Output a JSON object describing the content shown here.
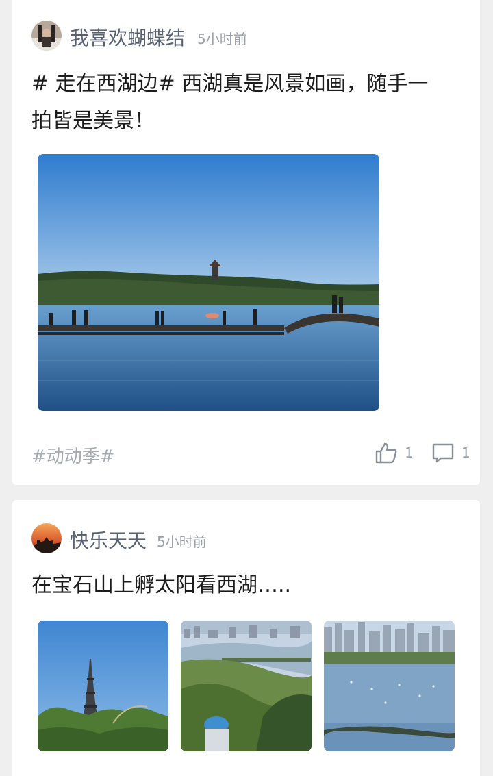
{
  "posts": [
    {
      "author": "我喜欢蝴蝶结",
      "time": "5小时前",
      "text_line1": "# 走在西湖边# 西湖真是风景如画，随手一",
      "text_line2": "拍皆是美景！",
      "topic": "#动动季#",
      "likes": "1",
      "comments": "1"
    },
    {
      "author": "快乐天天",
      "time": "5小时前",
      "text": "在宝石山上孵太阳看西湖…..",
      "images": [
        "pagoda-photo",
        "lake-view-photo",
        "city-lake-photo"
      ]
    }
  ],
  "colors": {
    "author_name": "#586272",
    "meta_gray": "#9aa0a8",
    "sky_blue": "#3f88d4",
    "lake_blue": "#2e6fb0"
  },
  "icons": [
    "thumbs-up-icon",
    "comment-icon"
  ]
}
